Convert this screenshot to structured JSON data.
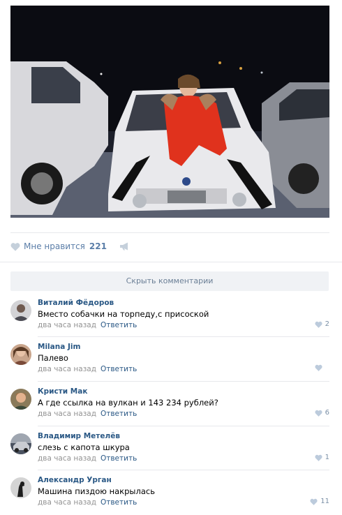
{
  "post": {
    "photo_alt": "photo",
    "likes": {
      "label": "Мне нравится",
      "count": "221"
    }
  },
  "comments_section": {
    "hide_label": "Скрыть комментарии",
    "items": [
      {
        "author": "Виталий Фёдоров",
        "text": "Вместо собачки на торпеду,с присоской",
        "time": "два часа назад",
        "reply": "Ответить",
        "likes": "2"
      },
      {
        "author": "Milana Jim",
        "text": "Палево",
        "time": "два часа назад",
        "reply": "Ответить",
        "likes": ""
      },
      {
        "author": "Кристи Мак",
        "text": "А где ссылка на вулкан и 143 234 рублей?",
        "time": "два часа назад",
        "reply": "Ответить",
        "likes": "6"
      },
      {
        "author": "Владимир Метелёв",
        "text": "слезь с капота шкура",
        "time": "два часа назад",
        "reply": "Ответить",
        "likes": "1"
      },
      {
        "author": "Александр Урган",
        "text": "Машина пиздою накрылась",
        "time": "два часа назад",
        "reply": "Ответить",
        "likes": "11"
      }
    ]
  },
  "colors": {
    "link": "#2a5885",
    "muted": "#939393",
    "like_blue": "#5b7ea8",
    "divider": "#e7e8ec",
    "button_bg": "#f0f2f5"
  },
  "icons": {
    "like": "heart-icon",
    "share": "megaphone-icon"
  }
}
